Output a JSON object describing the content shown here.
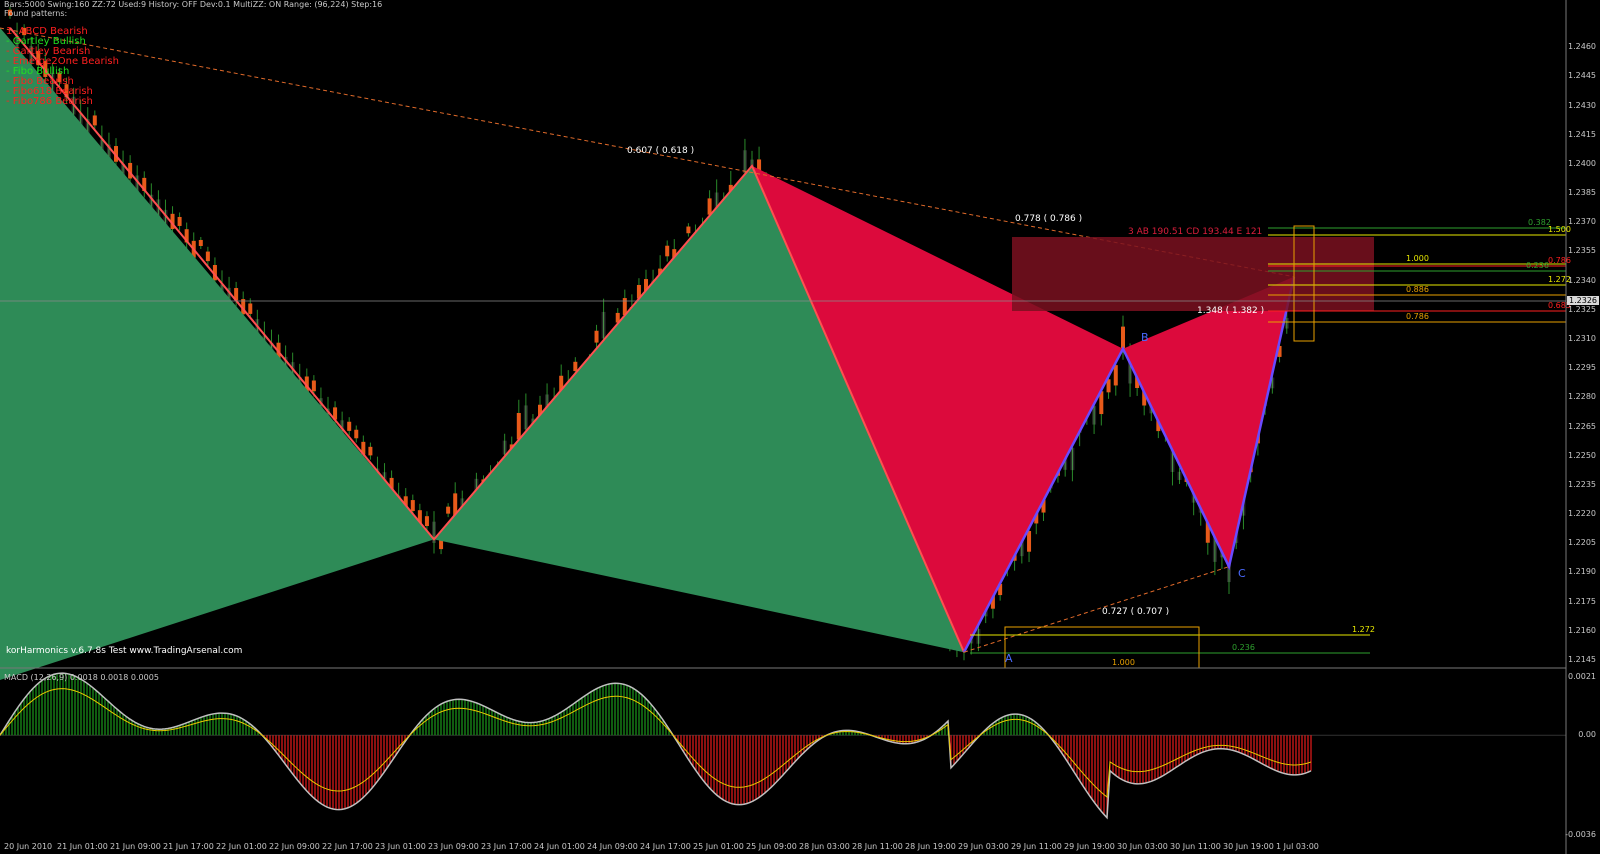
{
  "header": {
    "status_line": "Bars:5000  Swing:160  ZZ:72  Used:9  History: OFF Dev:0.1  MultiZZ: ON  Range: (96,224)  Step:16",
    "found_label": "Found patterns:"
  },
  "patterns": [
    {
      "label": "1. ABCD Bearish",
      "color": "#ff2020"
    },
    {
      "label": "- Gartley Bullish",
      "color": "#20e020"
    },
    {
      "label": "- Gartley Bearish",
      "color": "#ff2020"
    },
    {
      "label": "- Emerge2One Bearish",
      "color": "#ff2020"
    },
    {
      "label": "- Fibo Bullish",
      "color": "#20e020"
    },
    {
      "label": "- Fibo Bearish",
      "color": "#ff2020"
    },
    {
      "label": "- Fibo618 Bearish",
      "color": "#ff2020"
    },
    {
      "label": "- Fibo786 Bearish",
      "color": "#ff2020"
    }
  ],
  "footer_label": "korHarmonics v.6.7.8s Test www.TradingArsenal.com",
  "annotations": {
    "ratio_top": "0.607 ( 0.618 )",
    "ratio_right": "0.778 ( 0.786 )",
    "ratio_mid": "1.348 ( 1.382 )",
    "ratio_low": "0.727 ( 0.707 )",
    "ab_cd_line": "3   AB 190.51 CD 193.44   E 121",
    "point_b": "B",
    "point_c": "C",
    "point_a": "A"
  },
  "fib_levels": [
    {
      "label": "0.382",
      "color": "#2ea02e"
    },
    {
      "label": "1.500",
      "color": "#e8e800"
    },
    {
      "label": "1.000",
      "color": "#e8e800"
    },
    {
      "label": "0.786",
      "color": "#ff2020"
    },
    {
      "label": "0.236",
      "color": "#2ea02e"
    },
    {
      "label": "1.272",
      "color": "#e8e800"
    },
    {
      "label": "0.886",
      "color": "#e8a000"
    },
    {
      "label": "0.685",
      "color": "#ff2020"
    },
    {
      "label": "0.786",
      "color": "#e8a000"
    }
  ],
  "fib_levels_bottom": [
    {
      "label": "1.272",
      "color": "#e8e800"
    },
    {
      "label": "0.236",
      "color": "#2ea02e"
    },
    {
      "label": "1.000",
      "color": "#e8a000"
    }
  ],
  "price_axis": [
    "1.2460",
    "1.2445",
    "1.2430",
    "1.2415",
    "1.2400",
    "1.2385",
    "1.2370",
    "1.2355",
    "1.2340",
    "1.2325",
    "1.2310",
    "1.2295",
    "1.2280",
    "1.2265",
    "1.2250",
    "1.2235",
    "1.2220",
    "1.2205",
    "1.2190",
    "1.2175",
    "1.2160",
    "1.2145"
  ],
  "current_price": "1.2326",
  "macd": {
    "label": "MACD (12,26,9) 0.0018 0.0018 0.0005",
    "axis": [
      "0.0021",
      "0.00",
      "-0.0036"
    ]
  },
  "time_axis": [
    "20 Jun 2010",
    "21 Jun 01:00",
    "21 Jun 09:00",
    "21 Jun 17:00",
    "22 Jun 01:00",
    "22 Jun 09:00",
    "22 Jun 17:00",
    "23 Jun 01:00",
    "23 Jun 09:00",
    "23 Jun 17:00",
    "24 Jun 01:00",
    "24 Jun 09:00",
    "24 Jun 17:00",
    "25 Jun 01:00",
    "25 Jun 09:00",
    "28 Jun 03:00",
    "28 Jun 11:00",
    "28 Jun 19:00",
    "29 Jun 03:00",
    "29 Jun 11:00",
    "29 Jun 19:00",
    "30 Jun 03:00",
    "30 Jun 11:00",
    "30 Jun 19:00",
    "1 Jul 03:00"
  ],
  "chart_data": {
    "type": "line",
    "title": "",
    "price_range": [
      1.2145,
      1.2475
    ],
    "zigzag_points": [
      {
        "time": "20 Jun 2010",
        "price": 1.247
      },
      {
        "time": "23 Jun 09:00",
        "price": 1.2207
      },
      {
        "time": "25 Jun 09:00",
        "price": 1.2399
      },
      {
        "time": "29 Jun 03:00",
        "price": 1.2149
      },
      {
        "time": "30 Jun 03:00",
        "price": 1.2305
      },
      {
        "time": "30 Jun 19:00",
        "price": 1.2193
      },
      {
        "time": "1 Jul 03:00",
        "price": 1.2342
      }
    ],
    "macd_range": [
      -0.0036,
      0.0021
    ],
    "colors": {
      "bull_fill": "#2e8b57",
      "bear_fill": "#dc0a3c",
      "macd_pos": "#1a9a1a",
      "macd_neg": "#e81a1a",
      "signal": "#e8c800",
      "macd_line": "#c0c0c0"
    }
  }
}
